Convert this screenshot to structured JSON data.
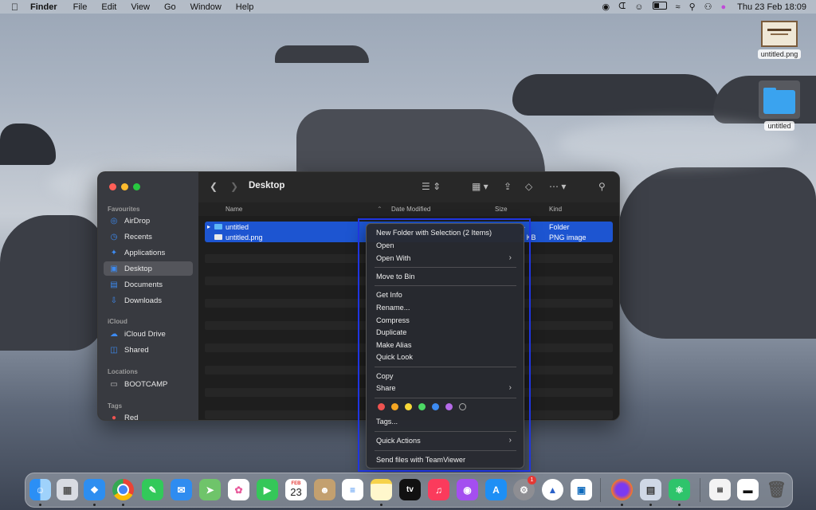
{
  "menubar": {
    "app": "Finder",
    "items": [
      "File",
      "Edit",
      "View",
      "Go",
      "Window",
      "Help"
    ],
    "clock": "Thu 23 Feb  18:09"
  },
  "desktop": {
    "icons": [
      {
        "label": "untitled.png",
        "type": "png-thumbnail-icon"
      },
      {
        "label": "untitled",
        "type": "folder-icon"
      }
    ]
  },
  "finder": {
    "title": "Desktop",
    "sidebar": {
      "sections": [
        {
          "head": "Favourites",
          "items": [
            {
              "label": "AirDrop",
              "icon": "airdrop-icon"
            },
            {
              "label": "Recents",
              "icon": "clock-icon"
            },
            {
              "label": "Applications",
              "icon": "applications-icon"
            },
            {
              "label": "Desktop",
              "icon": "desktop-icon",
              "selected": true
            },
            {
              "label": "Documents",
              "icon": "document-icon"
            },
            {
              "label": "Downloads",
              "icon": "download-icon"
            }
          ]
        },
        {
          "head": "iCloud",
          "items": [
            {
              "label": "iCloud Drive",
              "icon": "cloud-icon"
            },
            {
              "label": "Shared",
              "icon": "shared-folder-icon"
            }
          ]
        },
        {
          "head": "Locations",
          "items": [
            {
              "label": "BOOTCAMP",
              "icon": "disk-icon"
            }
          ]
        },
        {
          "head": "Tags",
          "items": [
            {
              "label": "Red",
              "icon": "red-tag-icon"
            }
          ]
        }
      ]
    },
    "columns": {
      "name": "Name",
      "date": "Date Modified",
      "size": "Size",
      "kind": "Kind"
    },
    "files": [
      {
        "name": "untitled",
        "size": "--",
        "kind": "Folder"
      },
      {
        "name": "untitled.png",
        "size": "5 KB",
        "kind": "PNG image"
      }
    ]
  },
  "context_menu": {
    "items": {
      "new_folder": "New Folder with Selection (2 Items)",
      "open": "Open",
      "open_with": "Open With",
      "move_to_bin": "Move to Bin",
      "get_info": "Get Info",
      "rename": "Rename...",
      "compress": "Compress",
      "duplicate": "Duplicate",
      "make_alias": "Make Alias",
      "quick_look": "Quick Look",
      "copy": "Copy",
      "share": "Share",
      "tags": "Tags...",
      "quick_actions": "Quick Actions",
      "send_teamviewer": "Send files with TeamViewer"
    },
    "tag_colors": [
      "#ef5350",
      "#f5a623",
      "#f8d838",
      "#4cd964",
      "#3d8bf2",
      "#b56ae8",
      "none"
    ]
  },
  "dock": {
    "calendar_month": "FEB",
    "calendar_day": "23",
    "settings_badge": "1",
    "tv_label": "tv"
  }
}
